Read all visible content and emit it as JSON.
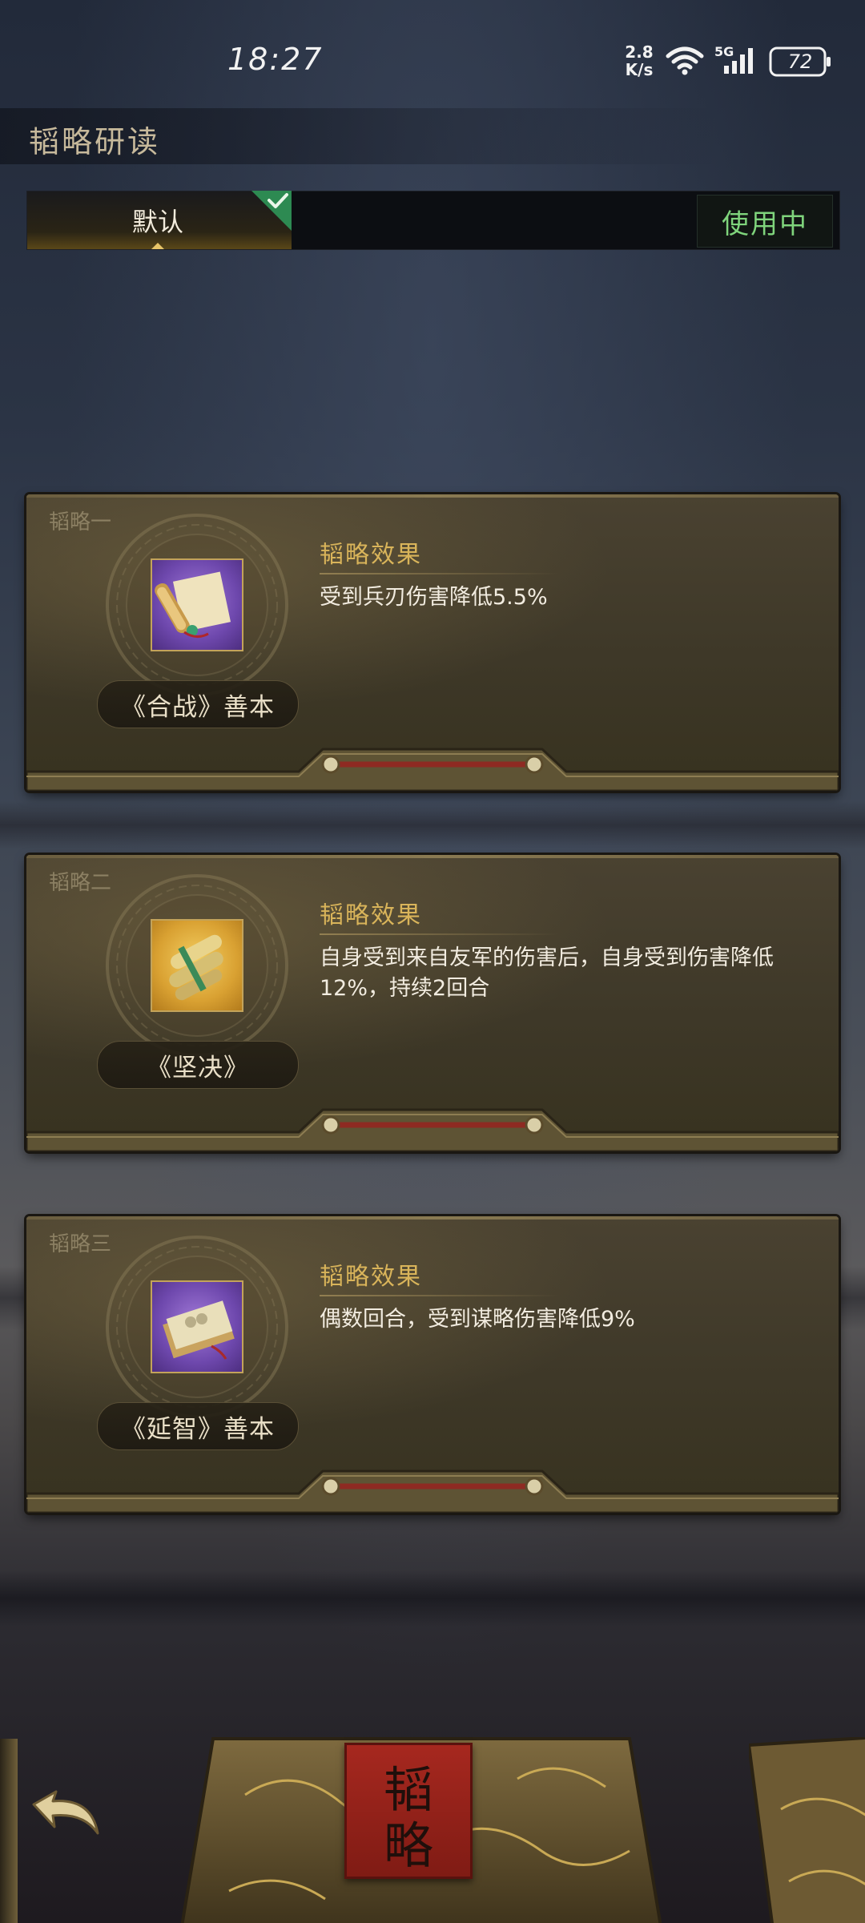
{
  "status_bar": {
    "time": "18:27",
    "net_speed_value": "2.8",
    "net_speed_unit": "K/s",
    "network_type": "5G",
    "battery_level": "72"
  },
  "header": {
    "title": "韬略研读"
  },
  "tabs": {
    "items": [
      {
        "label": "默认",
        "selected": true
      }
    ],
    "status_badge": "使用中"
  },
  "strategies": [
    {
      "index_label": "韬略一",
      "item_name": "《合战》善本",
      "item_rarity": "purple",
      "icon": "scroll-icon",
      "effect_title": "韬略效果",
      "effect_text": "受到兵刃伤害降低5.5%"
    },
    {
      "index_label": "韬略二",
      "item_name": "《坚决》",
      "item_rarity": "gold",
      "icon": "scroll-bundle-icon",
      "effect_title": "韬略效果",
      "effect_text": "自身受到来自友军的伤害后，自身受到伤害降低12%，持续2回合"
    },
    {
      "index_label": "韬略三",
      "item_name": "《延智》善本",
      "item_rarity": "purple",
      "icon": "book-icon",
      "effect_title": "韬略效果",
      "effect_text": "偶数回合，受到谋略伤害降低9%"
    }
  ],
  "footer": {
    "back_icon": "back-arrow-icon",
    "book_seal_text": "韬略"
  },
  "colors": {
    "accent_gold": "#d9b45a",
    "in_use_green": "#7fd47c",
    "card_bg": "#3e3828"
  }
}
